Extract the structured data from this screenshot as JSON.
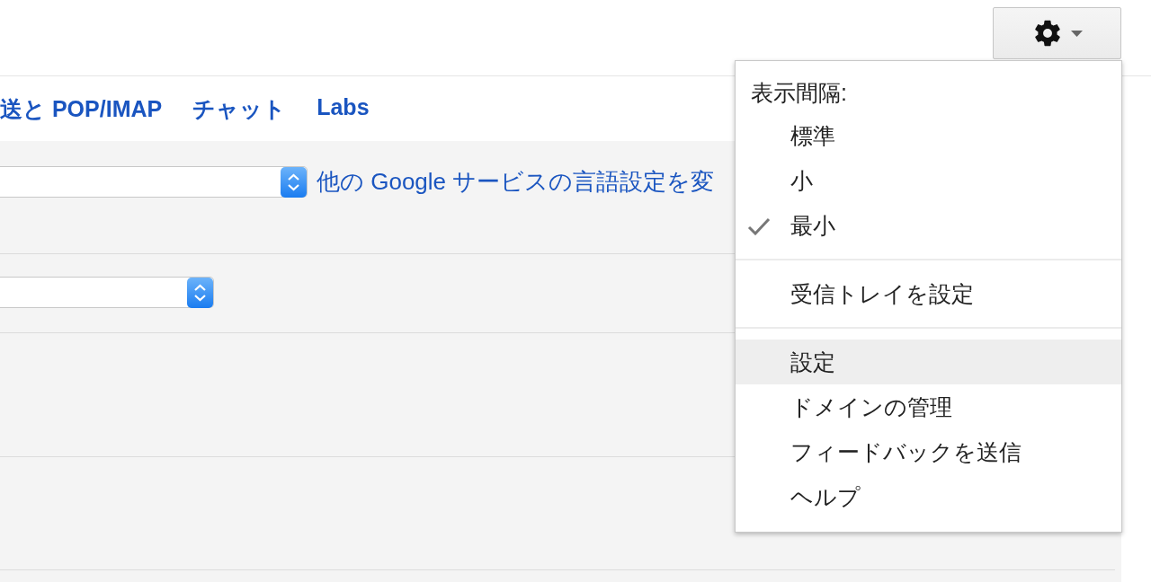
{
  "tabs": [
    {
      "label": "送と POP/IMAP"
    },
    {
      "label": "チャット"
    },
    {
      "label": "Labs"
    }
  ],
  "settings_rows": [
    {
      "kind": "select_link",
      "link": "他の Google サービスの言語設定を変"
    },
    {
      "kind": "select"
    },
    {
      "kind": "empty"
    },
    {
      "kind": "empty"
    }
  ],
  "menu": {
    "heading": "表示間隔:",
    "density_options": [
      {
        "label": "標準",
        "checked": false
      },
      {
        "label": "小",
        "checked": false
      },
      {
        "label": "最小",
        "checked": true
      }
    ],
    "groups": [
      [
        {
          "label": "受信トレイを設定",
          "highlighted": false
        }
      ],
      [
        {
          "label": "設定",
          "highlighted": true
        },
        {
          "label": "ドメインの管理",
          "highlighted": false
        },
        {
          "label": "フィードバックを送信",
          "highlighted": false
        },
        {
          "label": "ヘルプ",
          "highlighted": false
        }
      ]
    ]
  }
}
